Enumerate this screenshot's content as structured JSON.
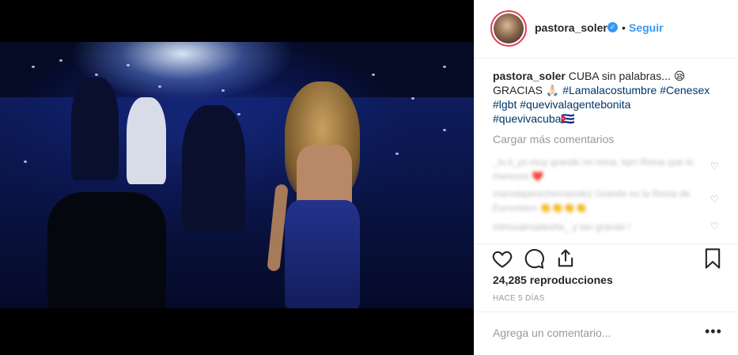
{
  "post": {
    "username": "pastora_soler",
    "separator": "•",
    "follow_label": "Seguir",
    "caption": {
      "username": "pastora_soler",
      "text_1": " CUBA sin palabras... 😪",
      "text_2": "GRACIAS 🙏🏻 ",
      "tags": [
        "#Lamalacostumbre",
        "#Cenesex",
        "#lgbt",
        "#quevivalagentebonita",
        "#quevivacuba🇨🇺"
      ]
    },
    "load_more_label": "Cargar más comentarios",
    "comments": [
      {
        "text": "_lo.li_ys muy grande mi reina, tqm Reina que lo mereces ❤️"
      },
      {
        "text": "manolaperezhernandez Grande es la Reina de Eurovision 👏👏👏👏"
      },
      {
        "text": "mihosalmadeshe_ y tan grande !"
      }
    ],
    "views": "24,285 reproducciones",
    "time_ago": "Hace 5 días",
    "comment_placeholder": "Agrega un comentario...",
    "more_label": "•••"
  },
  "colors": {
    "accent": "#3897f0",
    "text": "#262626",
    "muted": "#999999",
    "border": "#efefef"
  },
  "icons": [
    "verified-badge-icon",
    "heart-icon",
    "comment-icon",
    "share-icon",
    "bookmark-icon",
    "more-options-icon"
  ]
}
